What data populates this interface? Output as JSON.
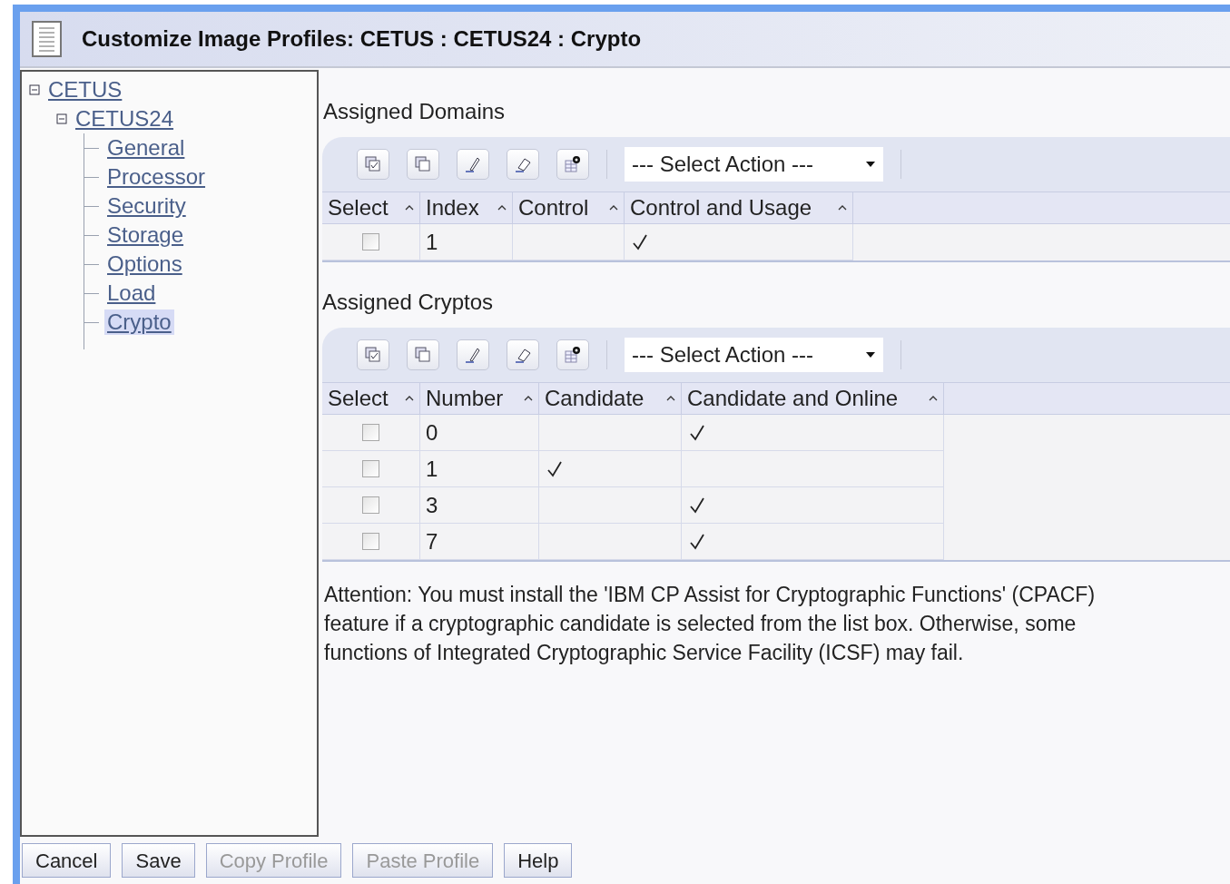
{
  "window": {
    "title": "Customize Image Profiles: CETUS : CETUS24 : Crypto"
  },
  "tree": [
    {
      "label": "CETUS",
      "expanded": true,
      "selected": false,
      "children": [
        {
          "label": "CETUS24",
          "expanded": true,
          "selected": false,
          "children": [
            {
              "label": "General",
              "selected": false
            },
            {
              "label": "Processor",
              "selected": false
            },
            {
              "label": "Security",
              "selected": false
            },
            {
              "label": "Storage",
              "selected": false
            },
            {
              "label": "Options",
              "selected": false
            },
            {
              "label": "Load",
              "selected": false
            },
            {
              "label": "Crypto",
              "selected": true
            }
          ]
        }
      ]
    }
  ],
  "domains": {
    "title": "Assigned Domains",
    "action_placeholder": "--- Select Action ---",
    "columns": [
      "Select",
      "Index",
      "Control",
      "Control and Usage"
    ],
    "rows": [
      {
        "checked": false,
        "index": "1",
        "control": false,
        "control_and_usage": true
      }
    ]
  },
  "cryptos": {
    "title": "Assigned Cryptos",
    "action_placeholder": "--- Select Action ---",
    "columns": [
      "Select",
      "Number",
      "Candidate",
      "Candidate and Online"
    ],
    "rows": [
      {
        "checked": false,
        "number": "0",
        "candidate": false,
        "candidate_and_online": true
      },
      {
        "checked": false,
        "number": "1",
        "candidate": true,
        "candidate_and_online": false
      },
      {
        "checked": false,
        "number": "3",
        "candidate": false,
        "candidate_and_online": true
      },
      {
        "checked": false,
        "number": "7",
        "candidate": false,
        "candidate_and_online": true
      }
    ]
  },
  "attention": "Attention: You must install the 'IBM CP Assist for Cryptographic Functions' (CPACF) feature if a cryptographic candidate is selected from the list box. Otherwise, some functions of Integrated Cryptographic Service Facility (ICSF) may fail.",
  "buttons": [
    {
      "label": "Cancel",
      "disabled": false
    },
    {
      "label": "Save",
      "disabled": false
    },
    {
      "label": "Copy Profile",
      "disabled": true
    },
    {
      "label": "Paste Profile",
      "disabled": true
    },
    {
      "label": "Help",
      "disabled": false
    }
  ]
}
